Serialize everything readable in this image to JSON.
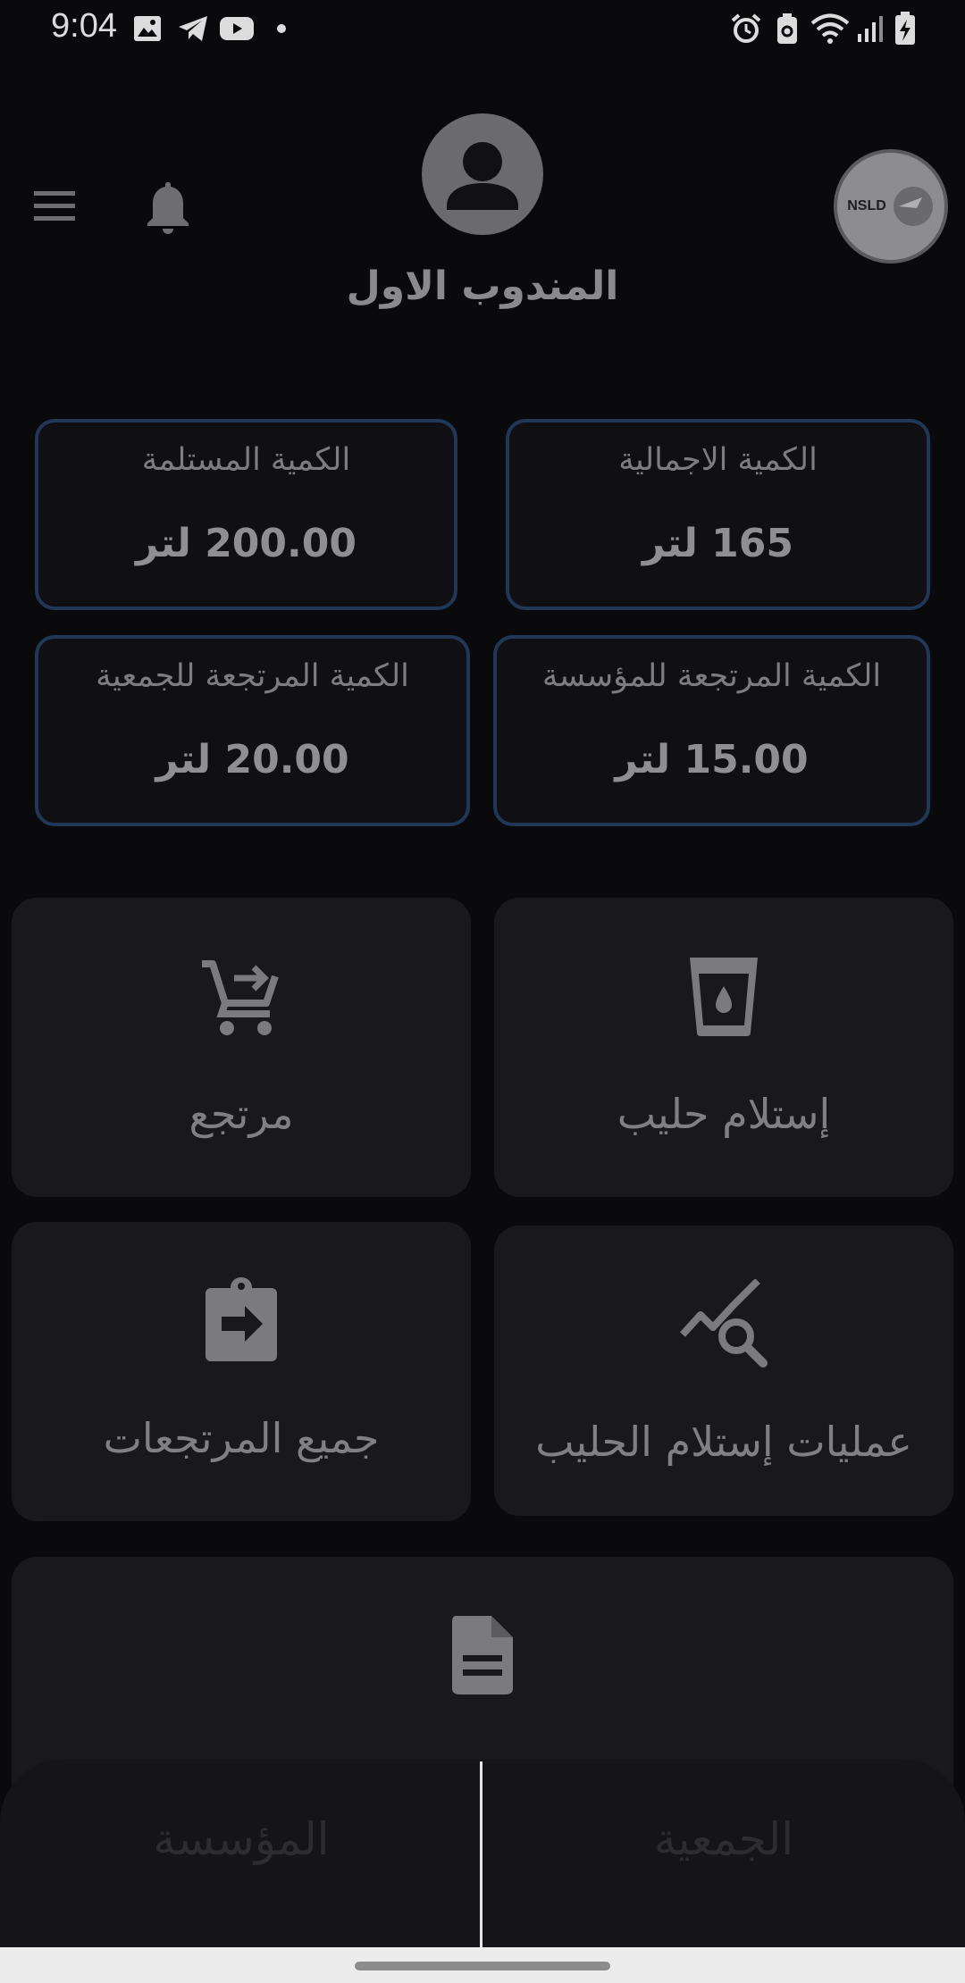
{
  "status_bar": {
    "time": "9:04",
    "left_icons": [
      "image-icon",
      "telegram-icon",
      "youtube-icon",
      "dot-icon"
    ],
    "right_icons": [
      "alarm-icon",
      "recycle-battery-icon",
      "wifi-icon",
      "signal-icon",
      "battery-charging-icon"
    ]
  },
  "header": {
    "username": "المندوب الاول",
    "logo_text": "NSLD"
  },
  "stats": {
    "total": {
      "label": "الكمية الاجمالية",
      "value": "165 لتر"
    },
    "received": {
      "label": "الكمية المستلمة",
      "value": "200.00 لتر"
    },
    "returned_institution": {
      "label": "الكمية المرتجعة للمؤسسة",
      "value": "15.00 لتر"
    },
    "returned_association": {
      "label": "الكمية المرتجعة للجمعية",
      "value": "20.00 لتر"
    }
  },
  "actions": {
    "receive_milk": {
      "label": "إستلام حليب",
      "icon": "cup-drop-icon"
    },
    "returned": {
      "label": "مرتجع",
      "icon": "cart-return-icon"
    },
    "receipt_operations": {
      "label": "عمليات إستلام الحليب",
      "icon": "chart-search-icon"
    },
    "all_returns": {
      "label": "جميع المرتجعات",
      "icon": "clipboard-arrow-icon"
    },
    "reports": {
      "label": "",
      "icon": "document-icon"
    }
  },
  "bottom_tabs": {
    "association": "الجمعية",
    "institution": "المؤسسة"
  },
  "colors": {
    "background": "#0a0a0d",
    "card_border": "#213757",
    "tile_bg": "#19191d"
  }
}
